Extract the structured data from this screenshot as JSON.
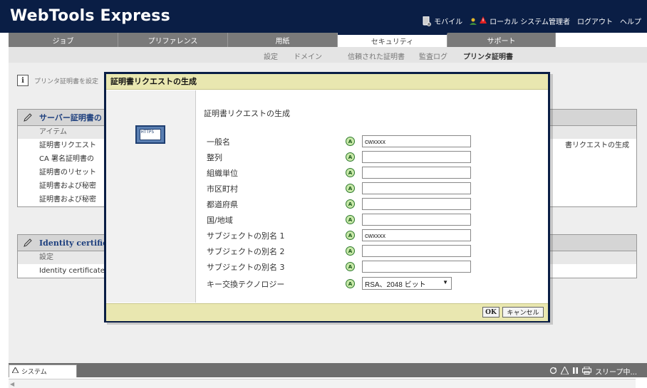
{
  "app": {
    "title": "WebTools Express"
  },
  "header": {
    "mobile_label": "モバイル",
    "admin_label": "ローカル システム管理者",
    "logout_label": "ログアウト",
    "help_label": "ヘルプ"
  },
  "tabs": [
    {
      "label": "ジョブ"
    },
    {
      "label": "プリファレンス"
    },
    {
      "label": "用紙"
    },
    {
      "label": "セキュリティ"
    },
    {
      "label": "サポート"
    }
  ],
  "subnav": [
    {
      "label": "設定"
    },
    {
      "label": "ドメイン"
    },
    {
      "label": "信頼された証明書"
    },
    {
      "label": "監査ログ"
    },
    {
      "label": "プリンタ証明書"
    }
  ],
  "main": {
    "info_text": "プリンタ証明書を設定",
    "server_cert": {
      "heading": "サーバー証明書の",
      "subheader": "アイテム",
      "rows": [
        {
          "label": "証明書リクエスト"
        },
        {
          "label": "CA 署名証明書の"
        },
        {
          "label": "証明書のリセット"
        },
        {
          "label": "証明書および秘密"
        },
        {
          "label": "証明書および秘密"
        }
      ],
      "right_text": "書リクエストの生成"
    },
    "identity": {
      "heading": "Identity certific",
      "subheader": "設定",
      "row": "Identity certificate"
    }
  },
  "dialog": {
    "title": "証明書リクエストの生成",
    "heading": "証明書リクエストの生成",
    "icon_text": "HTTPS",
    "fields": [
      {
        "label": "一般名",
        "value": "cwxxxx"
      },
      {
        "label": "整列",
        "value": ""
      },
      {
        "label": "組織単位",
        "value": ""
      },
      {
        "label": "市区町村",
        "value": ""
      },
      {
        "label": "都道府県",
        "value": ""
      },
      {
        "label": "国/地域",
        "value": ""
      },
      {
        "label": "サブジェクトの別名 1",
        "value": "cwxxxx"
      },
      {
        "label": "サブジェクトの別名 2",
        "value": ""
      },
      {
        "label": "サブジェクトの別名 3",
        "value": ""
      }
    ],
    "key_exchange": {
      "label": "キー交換テクノロジー",
      "value": "RSA、2048 ビット"
    },
    "ok_label": "OK",
    "cancel_label": "キャンセル"
  },
  "statusbar": {
    "system_label": "システム",
    "status_text": "スリープ中..."
  },
  "colors": {
    "header_bg": "#0a1e45",
    "dialog_title_bg": "#e9e7b0",
    "section_heading": "#1d3f7e"
  }
}
